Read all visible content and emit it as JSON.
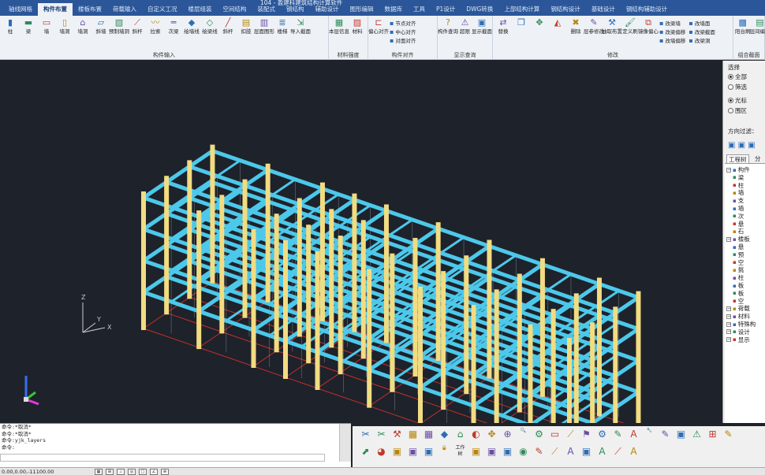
{
  "window": {
    "title": "104 - 盈建科建筑结构计算软件"
  },
  "tabs": [
    "轴线网格",
    "构件布置",
    "楼板布置",
    "荷载输入",
    "自定义工况",
    "楼层组装",
    "空间结构",
    "装配式",
    "钢结构",
    "辅助设计",
    "图形编辑",
    "数据库",
    "工具",
    "P1设计",
    "DWG转换",
    "上部结构计算",
    "钢结构设计",
    "基础设计",
    "钢结构辅助设计"
  ],
  "active_tab_index": 1,
  "ribbon": {
    "groups": [
      {
        "title": "构件输入",
        "buttons": [
          {
            "label": "柱",
            "icon": "column-icon"
          },
          {
            "label": "梁",
            "icon": "beam-icon"
          },
          {
            "label": "墙",
            "icon": "wall-icon"
          },
          {
            "label": "墙洞",
            "icon": "wall-hole-icon"
          },
          {
            "label": "墙洞",
            "icon": "door-window-icon"
          },
          {
            "label": "斜墙",
            "icon": "slant-wall-icon"
          },
          {
            "label": "预制墙洞",
            "icon": "precast-wall-icon"
          },
          {
            "label": "斜杆",
            "icon": "brace-icon"
          },
          {
            "label": "拉索",
            "icon": "cable-icon"
          },
          {
            "label": "次梁",
            "icon": "secondary-beam-icon"
          },
          {
            "label": "绘墙线",
            "icon": "draw-wall-icon"
          },
          {
            "label": "绘梁线",
            "icon": "draw-beam-icon"
          },
          {
            "label": "斜杆",
            "icon": "slant-brace-icon"
          },
          {
            "label": "扣肢",
            "icon": "pier-icon"
          },
          {
            "label": "层面图形",
            "icon": "floor-graph-icon"
          },
          {
            "label": "楼梯",
            "icon": "stair-icon"
          },
          {
            "label": "导入截面",
            "icon": "import-section-icon"
          }
        ]
      },
      {
        "title": "材料强度",
        "buttons": [
          {
            "label": "本层信息",
            "icon": "floor-info-icon"
          },
          {
            "label": "材料",
            "icon": "material-icon"
          }
        ]
      },
      {
        "title": "构件对齐",
        "buttons": [
          {
            "label": "偏心对齐",
            "icon": "eccentric-align-icon"
          }
        ],
        "side": [
          "节点对齐",
          "中心对齐",
          "对面对齐"
        ]
      },
      {
        "title": "显示查询",
        "buttons": [
          {
            "label": "构件查询",
            "icon": "query-icon"
          },
          {
            "label": "超限",
            "icon": "exceed-icon"
          },
          {
            "label": "显示截面",
            "icon": "show-section-icon"
          }
        ]
      },
      {
        "title": "修改",
        "buttons": [
          {
            "label": "替换",
            "icon": "replace-icon"
          },
          {
            "label": "",
            "icon": "copy-icon"
          },
          {
            "label": "",
            "icon": "move-icon"
          },
          {
            "label": "",
            "icon": "mirror-icon"
          },
          {
            "label": "删除",
            "icon": "delete-icon"
          },
          {
            "label": "层参修改",
            "icon": "modify-icon"
          },
          {
            "label": "抽取布置",
            "icon": "extract-icon"
          },
          {
            "label": "定义刷",
            "icon": "brush-icon"
          },
          {
            "label": "镜像偏心",
            "icon": "mirror-offset-icon"
          }
        ],
        "side": [
          "改梁墙",
          "改墙面",
          "改梁偏移",
          "改梁截面",
          "改墙偏移",
          "改梁洞"
        ]
      },
      {
        "title": "组合截面",
        "buttons": [
          {
            "label": "阳台刷",
            "icon": "balcony-icon"
          },
          {
            "label": "层间编辑",
            "icon": "floor-edit-icon"
          }
        ]
      }
    ]
  },
  "panel": {
    "select_title": "选择",
    "select_options": [
      "全部",
      "筛选"
    ],
    "pick_options": [
      "光标",
      "围区"
    ],
    "direction_label": "方向过滤：",
    "tree_tab": "工程树",
    "tree_tab2": "分",
    "tree_items": [
      {
        "label": "构件",
        "depth": 0
      },
      {
        "label": "梁",
        "depth": 1
      },
      {
        "label": "柱",
        "depth": 1
      },
      {
        "label": "墙",
        "depth": 1
      },
      {
        "label": "支",
        "depth": 1
      },
      {
        "label": "墙",
        "depth": 1
      },
      {
        "label": "次",
        "depth": 1
      },
      {
        "label": "悬",
        "depth": 1
      },
      {
        "label": "石",
        "depth": 1
      },
      {
        "label": "楼板",
        "depth": 0
      },
      {
        "label": "悬",
        "depth": 1
      },
      {
        "label": "预",
        "depth": 1
      },
      {
        "label": "空",
        "depth": 1
      },
      {
        "label": "挑",
        "depth": 1
      },
      {
        "label": "柱",
        "depth": 1
      },
      {
        "label": "板",
        "depth": 1
      },
      {
        "label": "板",
        "depth": 1
      },
      {
        "label": "空",
        "depth": 1
      },
      {
        "label": "荷载",
        "depth": 0
      },
      {
        "label": "材料",
        "depth": 0
      },
      {
        "label": "特殊构",
        "depth": 0
      },
      {
        "label": "设计",
        "depth": 0
      },
      {
        "label": "显示",
        "depth": 0
      }
    ]
  },
  "command": {
    "lines": [
      "命令:*取消*",
      "命令:*取消*",
      "命令:yjk_layers",
      "命令:"
    ],
    "input": ""
  },
  "toolbox": {
    "row1": [
      "✂",
      "✂",
      "⚒",
      "▦",
      "▦",
      "◆",
      "⌂",
      "◐",
      "✥",
      "⊕",
      "🔍",
      "⚙",
      "▭",
      "⟋",
      "⚑",
      "⚙",
      "✎",
      "A",
      "🔧",
      "✎",
      "▣",
      "⚠",
      "⊞",
      "✎"
    ],
    "row2": [
      "⬈",
      "◕",
      "▣",
      "▣",
      "▣",
      "🔒",
      "工作树",
      "▣",
      "▣",
      "▣",
      "◉",
      "✎",
      "⟋",
      "A",
      "▣",
      "A",
      "⟋",
      "A"
    ]
  },
  "status": {
    "coords": "0.00,0.00,-11100.00"
  },
  "colors": {
    "viewport_bg": "#1e222b",
    "beam": "#4cc8ea",
    "column": "#f2dc82",
    "base_grid": "#c0302b"
  }
}
